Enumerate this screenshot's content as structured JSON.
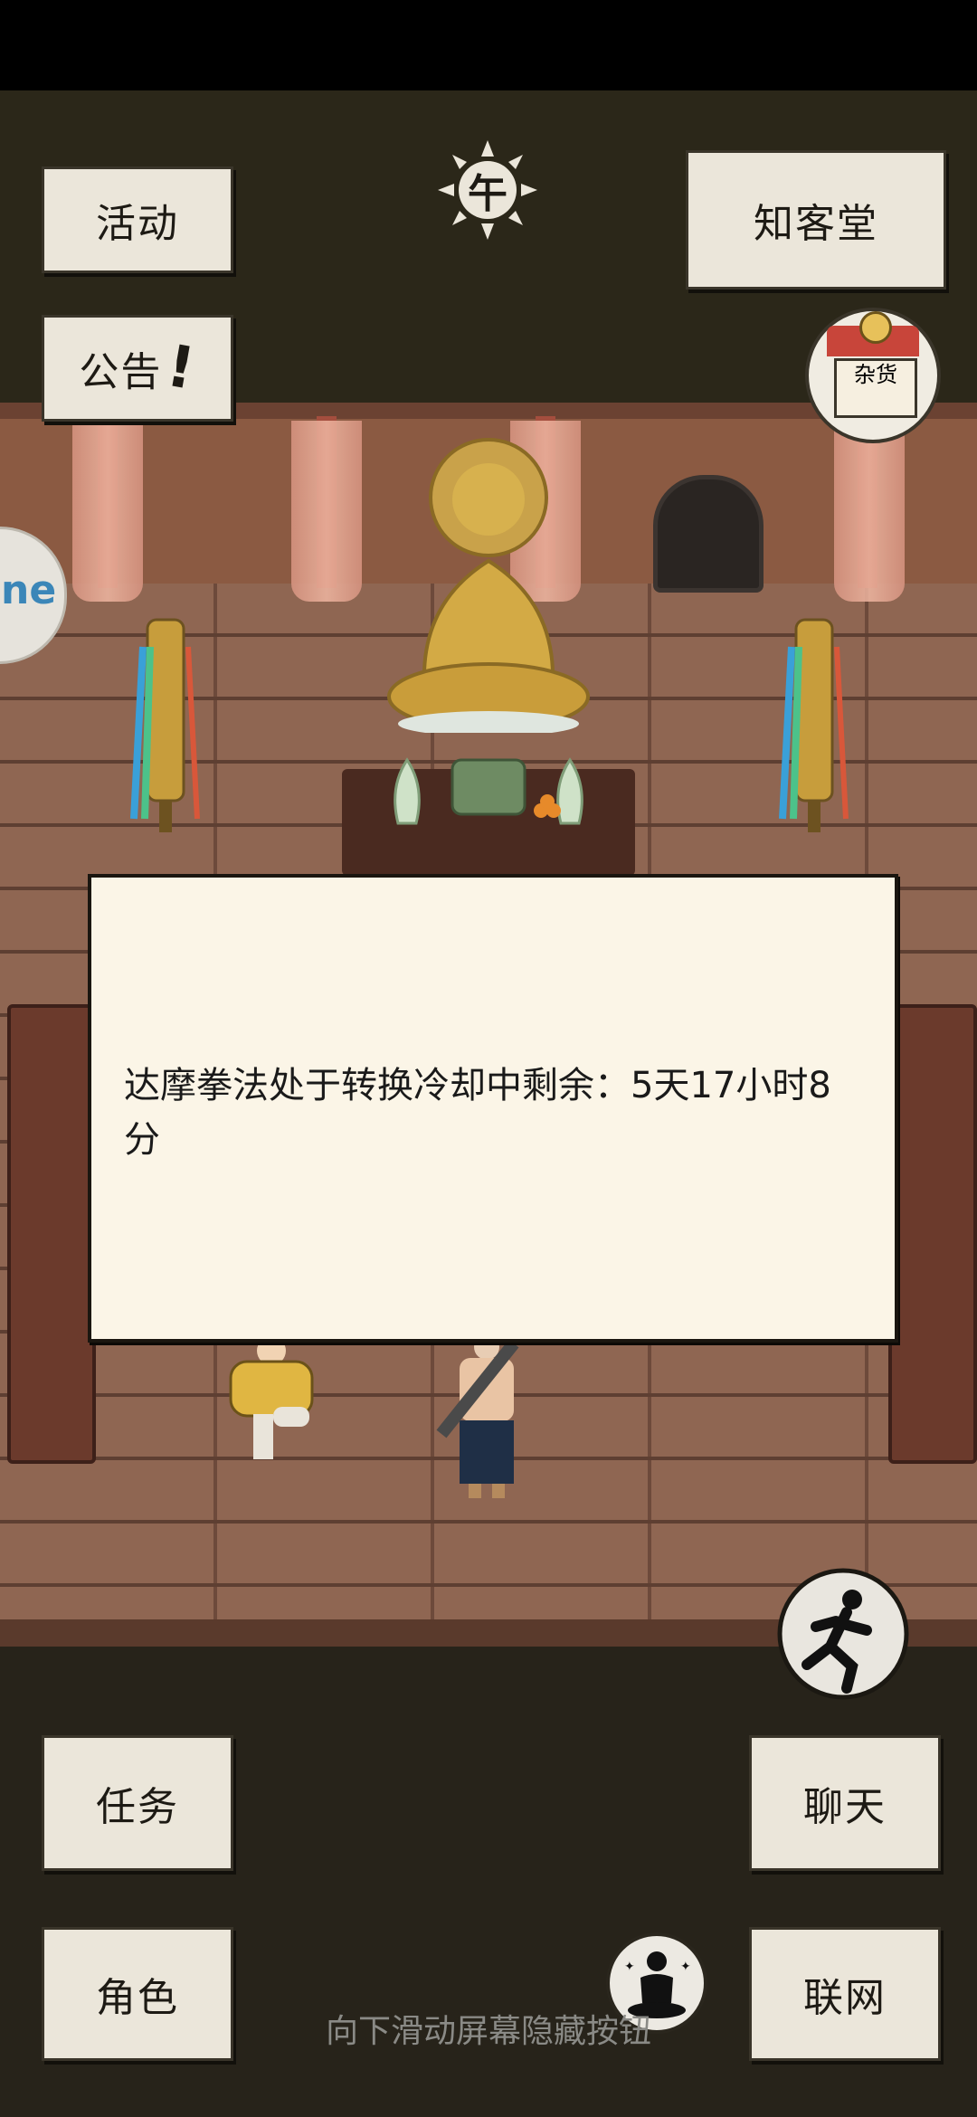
{
  "top_buttons": {
    "activity": "活动",
    "notice": "公告",
    "guest_hall": "知客堂"
  },
  "time_badge": "午",
  "shop_sign": "杂货",
  "dialog": {
    "message": "达摩拳法处于转换冷却中剩余：5天17小时8分"
  },
  "bottom_buttons": {
    "task": "任务",
    "chat": "聊天",
    "character": "角色",
    "network": "联网"
  },
  "hint": "向下滑动屏幕隐藏按钮",
  "side_tab": "ne",
  "colors": {
    "button_bg": "#ebe6da",
    "dialog_bg": "#fbf5e7",
    "floor": "#8f6652",
    "dark_bg": "#27231a"
  }
}
